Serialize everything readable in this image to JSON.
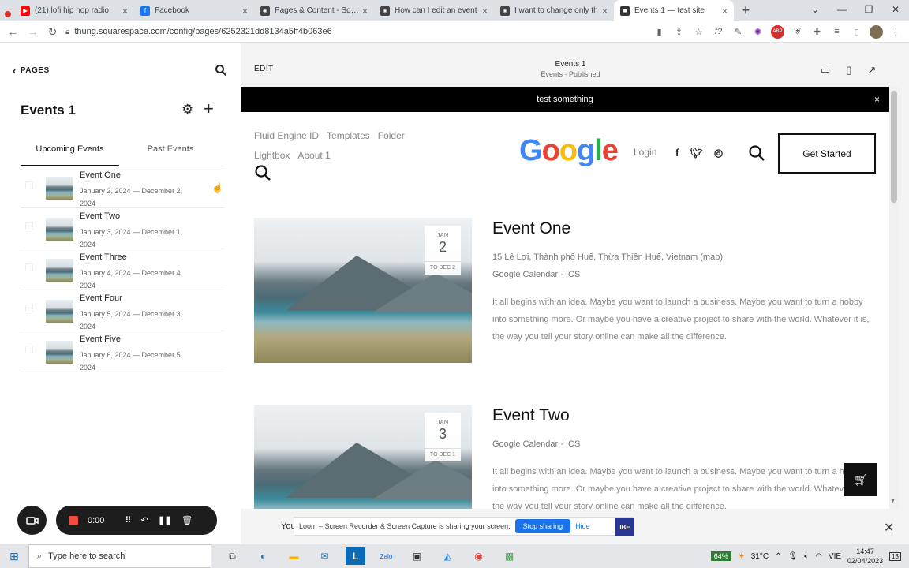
{
  "browser": {
    "tabs": [
      {
        "title": "(21) lofi hip hop radio",
        "fav_color": "#ff0000",
        "fav_glyph": "▶"
      },
      {
        "title": "Facebook",
        "fav_color": "#1877f2",
        "fav_glyph": "f"
      },
      {
        "title": "Pages & Content - Squa",
        "fav_color": "#444444",
        "fav_glyph": "◈"
      },
      {
        "title": "How can I edit an event",
        "fav_color": "#444444",
        "fav_glyph": "◈"
      },
      {
        "title": "I want to change only th",
        "fav_color": "#444444",
        "fav_glyph": "◈"
      },
      {
        "title": "Events 1 — test site",
        "fav_color": "#333333",
        "fav_glyph": "■"
      }
    ],
    "url": "thung.squarespace.com/config/pages/6252321dd8134a5ff4b063e6"
  },
  "sidebar": {
    "back_label": "PAGES",
    "title": "Events 1",
    "tab_upcoming": "Upcoming Events",
    "tab_past": "Past Events",
    "events": [
      {
        "name": "Event One",
        "dates": "January 2, 2024 — December 2, 2024"
      },
      {
        "name": "Event Two",
        "dates": "January 3, 2024 — December 1, 2024"
      },
      {
        "name": "Event Three",
        "dates": "January 4, 2024 — December 4, 2024"
      },
      {
        "name": "Event Four",
        "dates": "January 5, 2024 — December 3, 2024"
      },
      {
        "name": "Event Five",
        "dates": "January 6, 2024 — December 5, 2024"
      }
    ]
  },
  "preview_header": {
    "edit": "EDIT",
    "title": "Events 1",
    "subtitle": "Events · Published"
  },
  "site": {
    "announcement": "test something",
    "nav_links_row1": [
      "Fluid Engine ID",
      "Templates",
      "Folder"
    ],
    "nav_links_row2": [
      "Lightbox",
      "About 1"
    ],
    "logo_letters": [
      "G",
      "o",
      "o",
      "g",
      "l",
      "e"
    ],
    "login": "Login",
    "cta": "Get Started",
    "events": [
      {
        "month": "JAN",
        "day": "2",
        "to": "TO DEC 2",
        "title": "Event One",
        "address": "15 Lê Lợi, Thành phố Huế, Thừa Thiên Huế, Vietnam (map)",
        "calendar": "Google Calendar · ICS",
        "description": "It all begins with an idea. Maybe you want to launch a business. Maybe you want to turn a hobby into something more. Or maybe you have a creative project to share with the world. Whatever it is, the way you tell your story online can make all the difference."
      },
      {
        "month": "JAN",
        "day": "3",
        "to": "TO DEC 1",
        "title": "Event Two",
        "address": "",
        "calendar": "Google Calendar · ICS",
        "description": "It all begins with an idea. Maybe you want to launch a business. Maybe you want to turn a hobby into something more. Or maybe you have a creative project to share with the world. Whatever it is, the way you tell your story online can make all the difference."
      }
    ]
  },
  "recorder": {
    "time": "0:00"
  },
  "share_banner": {
    "you": "You",
    "text": "Loom – Screen Recorder & Screen Capture is sharing your screen.",
    "stop": "Stop sharing",
    "hide": "Hide",
    "subscribe": "IBE"
  },
  "taskbar": {
    "search_placeholder": "Type here to search",
    "battery": "64%",
    "weather": "31°C",
    "lang": "VIE",
    "time": "14:47",
    "date": "02/04/2023",
    "notifications": "13"
  }
}
